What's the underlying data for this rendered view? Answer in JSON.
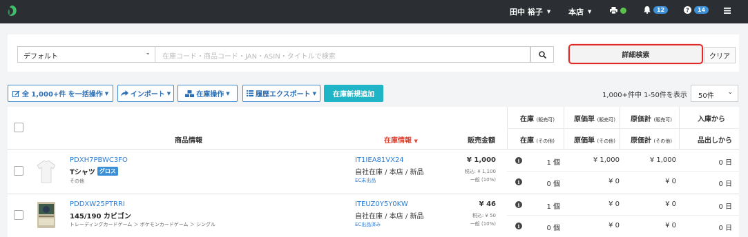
{
  "topbar": {
    "user_name": "田中 裕子",
    "store": "本店",
    "notifications_count": "12",
    "help_count": "14",
    "accent_color": "#2b2f33",
    "badge_color": "#3d8fd6",
    "status_color": "#5cc24d"
  },
  "search": {
    "preset_value": "デフォルト",
    "placeholder": "在庫コード・商品コード・JAN・ASIN・タイトルで検索",
    "advanced_label": "詳細検索",
    "clear_label": "クリア"
  },
  "toolbar": {
    "bulk_label": "全 1,000+件 を一括操作",
    "import_label": "インポート",
    "stock_ops_label": "在庫操作",
    "history_export_label": "履歴エクスポート",
    "add_stock_label": "在庫新規追加",
    "page_info": "1,000+件中 1-50件を表示",
    "per_page_value": "50件"
  },
  "table": {
    "headers": {
      "product_info": "商品情報",
      "stock_info": "在庫情報",
      "sale_price": "販売金額",
      "stock_sellable": "在庫",
      "stock_sellable_sub": "(販売可)",
      "unit_cost_sellable": "原価単",
      "unit_cost_sellable_sub": "(販売可)",
      "total_cost_sellable": "原価計",
      "total_cost_sellable_sub": "(販売可)",
      "since_stock": "入庫から",
      "stock_other": "在庫",
      "stock_other_sub": "(その他)",
      "unit_cost_other": "原価単",
      "unit_cost_other_sub": "(その他)",
      "total_cost_other": "原価計",
      "total_cost_other_sub": "(その他)",
      "since_listing": "品出しから"
    },
    "rows": [
      {
        "sku": "PDXH7PBWC3FO",
        "name": "Tシャツ",
        "tag": "グロス",
        "category": "その他",
        "stock_code": "IT1IEA81VX24",
        "stock_location": "自社在庫 / 本店 / 新品",
        "ec_status": "EC未出品",
        "price": "¥ 1,000",
        "tax_incl": "税込: ¥ 1,100",
        "tax_rate": "一般 (10%)",
        "sellable_qty": "1 個",
        "sellable_unit_cost": "¥ 1,000",
        "sellable_total_cost": "¥ 1,000",
        "days_since_stock": "0 日",
        "other_qty": "0 個",
        "other_unit_cost": "¥ 0",
        "other_total_cost": "¥ 0",
        "days_since_listing": "0 日"
      },
      {
        "sku": "PDDXW25PTRRI",
        "name": "145/190 カビゴン",
        "tag": "",
        "category": "トレーディングカードゲーム ＞ ポケモンカードゲーム ＞ シングル",
        "stock_code": "ITEUZ0Y5Y0KW",
        "stock_location": "自社在庫 / 本店 / 新品",
        "ec_status": "EC出品済み",
        "price": "¥ 46",
        "tax_incl": "税込: ¥ 50",
        "tax_rate": "一般 (10%)",
        "sellable_qty": "1 個",
        "sellable_unit_cost": "¥ 0",
        "sellable_total_cost": "¥ 0",
        "days_since_stock": "0 日",
        "other_qty": "0 個",
        "other_unit_cost": "¥ 0",
        "other_total_cost": "¥ 0",
        "days_since_listing": "0 日"
      }
    ]
  }
}
